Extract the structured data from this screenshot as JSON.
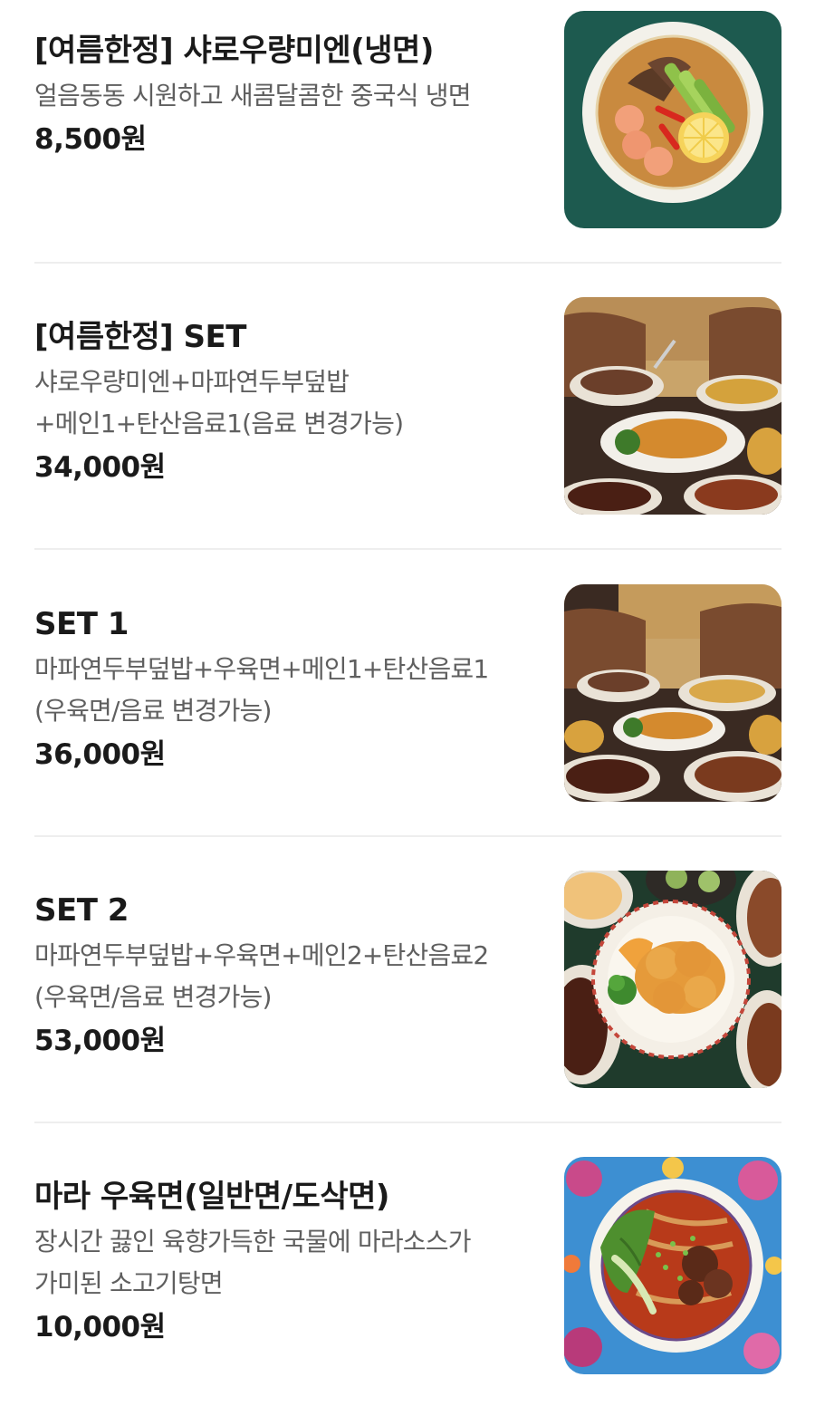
{
  "menu": {
    "items": [
      {
        "title": "[여름한정] 샤로우량미엔(냉면)",
        "description": "얼음동동 시원하고 새콤달콤한 중국식 냉면",
        "price": "8,500원",
        "image_icon": "cold-noodle-bowl-photo"
      },
      {
        "title": "[여름한정] SET",
        "description": "샤로우량미엔+마파연두부덮밥+메인1+탄산음료1(음료 변경가능)",
        "price": "34,000원",
        "image_icon": "set-meal-table-photo"
      },
      {
        "title": "SET 1",
        "description": "마파연두부덮밥+우육면+메인1+탄산음료1 (우육면/음료 변경가능)",
        "price": "36,000원",
        "image_icon": "set-meal-table-photo"
      },
      {
        "title": "SET 2",
        "description": "마파연두부덮밥+우육면+메인2+탄산음료2 (우육면/음료 변경가능)",
        "price": "53,000원",
        "image_icon": "sweet-sour-pork-platter-photo"
      },
      {
        "title": "마라 우육면(일반면/도삭면)",
        "description": "장시간 끓인 육향가득한 국물에 마라소스가 가미된 소고기탕면",
        "price": "10,000원",
        "image_icon": "mala-beef-noodle-bowl-photo"
      }
    ]
  },
  "colors": {
    "background": "#ffffff",
    "title_text": "#1a1a1a",
    "description_text": "#5f5f5f",
    "divider": "#eeeeee"
  }
}
